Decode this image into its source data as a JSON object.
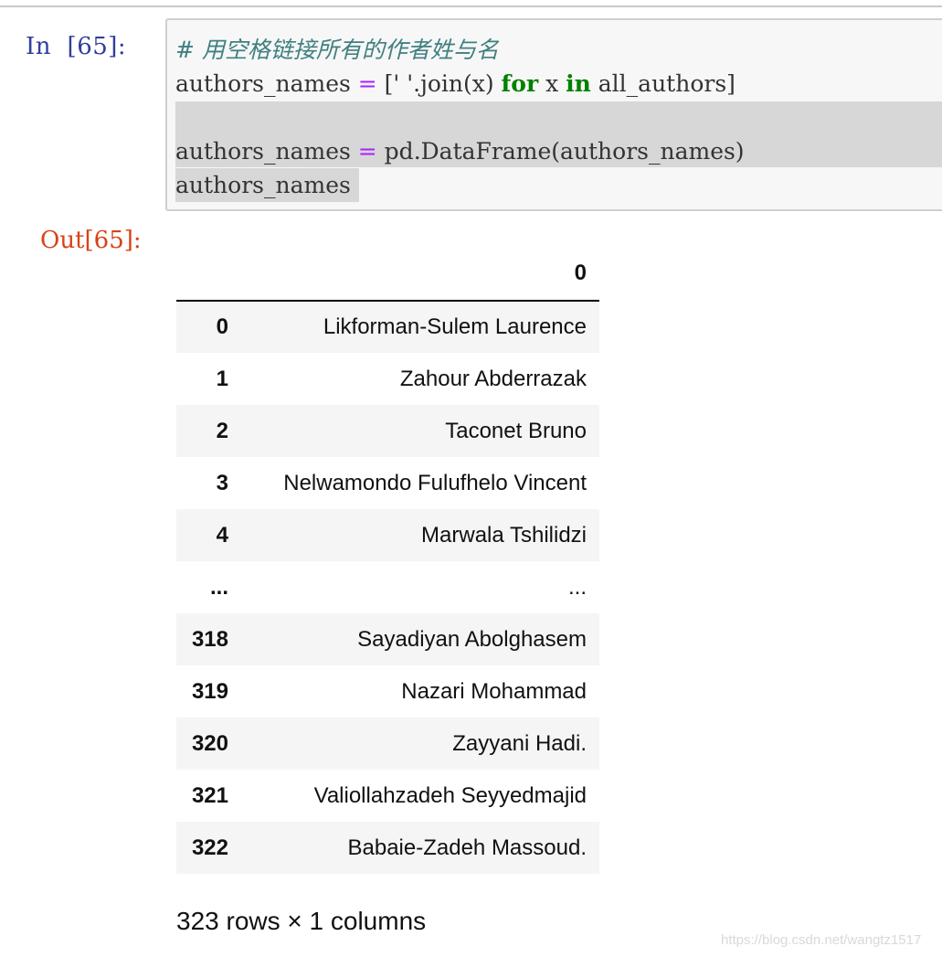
{
  "input_cell": {
    "prompt": "In  [65]:",
    "code_lines": [
      [
        {
          "text": "# 用空格链接所有的作者姓与名",
          "cls": "comment"
        }
      ],
      [
        {
          "text": "authors_names ",
          "cls": ""
        },
        {
          "text": "=",
          "cls": "op"
        },
        {
          "text": " [' '.join(x) ",
          "cls": ""
        },
        {
          "text": "for",
          "cls": "kw"
        },
        {
          "text": " x ",
          "cls": ""
        },
        {
          "text": "in",
          "cls": "kw"
        },
        {
          "text": " all_authors]",
          "cls": ""
        }
      ],
      [
        {
          "text": "",
          "cls": ""
        }
      ],
      [
        {
          "text": "authors_names ",
          "cls": ""
        },
        {
          "text": "=",
          "cls": "op"
        },
        {
          "text": " pd.DataFrame(authors_names)",
          "cls": ""
        }
      ],
      [
        {
          "text": "authors_names",
          "cls": ""
        }
      ]
    ]
  },
  "output_cell": {
    "prompt": "Out[65]:",
    "table": {
      "columns": [
        "",
        "0"
      ],
      "rows": [
        {
          "index": "0",
          "value": "Likforman-Sulem Laurence"
        },
        {
          "index": "1",
          "value": "Zahour Abderrazak"
        },
        {
          "index": "2",
          "value": "Taconet Bruno"
        },
        {
          "index": "3",
          "value": "Nelwamondo Fulufhelo Vincent"
        },
        {
          "index": "4",
          "value": "Marwala Tshilidzi"
        },
        {
          "index": "...",
          "value": "..."
        },
        {
          "index": "318",
          "value": "Sayadiyan Abolghasem"
        },
        {
          "index": "319",
          "value": "Nazari Mohammad"
        },
        {
          "index": "320",
          "value": "Zayyani Hadi."
        },
        {
          "index": "321",
          "value": "Valiollahzadeh Seyyedmajid"
        },
        {
          "index": "322",
          "value": "Babaie-Zadeh Massoud."
        }
      ]
    },
    "shape_info": "323 rows × 1 columns"
  },
  "watermark": "https://blog.csdn.net/wangtz1517",
  "colors": {
    "in_prompt": "#303f9f",
    "out_prompt": "#d84315",
    "comment": "#408080",
    "keyword": "#008000",
    "operator": "#aa22ff"
  }
}
